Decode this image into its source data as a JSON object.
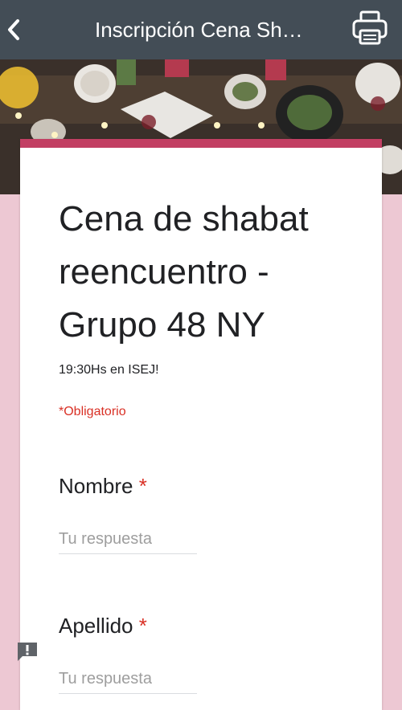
{
  "topbar": {
    "title": "Inscripción Cena Sh…",
    "back_icon": "chevron-left-icon",
    "print_icon": "printer-icon"
  },
  "banner": {
    "image": "dinner-table-photo"
  },
  "form": {
    "title": "Cena de shabat reencuentro - Grupo 48 NY",
    "description": "19:30Hs en ISEJ!",
    "required_note": "*Obligatorio",
    "accent_color": "#c23f63",
    "questions": [
      {
        "label": "Nombre",
        "required_mark": "*",
        "placeholder": "Tu respuesta"
      },
      {
        "label": "Apellido",
        "required_mark": "*",
        "placeholder": "Tu respuesta"
      }
    ]
  },
  "feedback": {
    "icon": "report-feedback-icon"
  }
}
